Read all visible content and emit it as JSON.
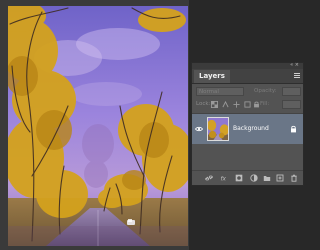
{
  "layers_panel": {
    "tab_label": "Layers",
    "blend_mode": "Normal",
    "opacity_label": "Opacity:",
    "lock_label": "Lock:",
    "fill_label": "Fill:",
    "layers": [
      {
        "name": "Background",
        "visible": true,
        "locked": true,
        "selected": true
      }
    ]
  },
  "canvas": {
    "image_description_icon": "tree-lined-road-photo"
  },
  "icons": {
    "collapse": "collapse-icon",
    "menu": "panel-menu-icon",
    "eye": "eye-icon",
    "lock": "lock-icon"
  },
  "colors": {
    "panel_bg": "#535353",
    "selected_row": "#6a7687",
    "canvas_bg": "#3a3a3a"
  }
}
